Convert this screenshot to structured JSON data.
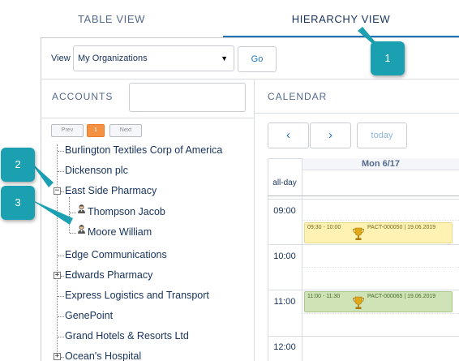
{
  "tabs": {
    "table_view": "TABLE VIEW",
    "hierarchy_view": "HIERARCHY VIEW"
  },
  "toolbar": {
    "view_label": "View",
    "view_selected": "My Organizations",
    "go_label": "Go"
  },
  "accounts": {
    "title": "ACCOUNTS",
    "search_value": "",
    "pager": {
      "prev": "Prev",
      "page": "1",
      "next": "Next"
    },
    "items": [
      {
        "label": "Burlington Textiles Corp of America"
      },
      {
        "label": "Dickenson plc"
      },
      {
        "label": "East Side Pharmacy",
        "toggle": "−"
      },
      {
        "label": "Thompson Jacob",
        "icon": "person-icon"
      },
      {
        "label": "Moore William",
        "icon": "person-icon"
      },
      {
        "label": "Edge Communications"
      },
      {
        "label": "Edwards Pharmacy",
        "toggle": "+"
      },
      {
        "label": "Express Logistics and Transport"
      },
      {
        "label": "GenePoint"
      },
      {
        "label": "Grand Hotels & Resorts Ltd"
      },
      {
        "label": "Ocean's Hospital",
        "toggle": "+"
      }
    ]
  },
  "calendar": {
    "title": "CALENDAR",
    "prev_icon": "‹",
    "next_icon": "›",
    "today_label": "today",
    "day_header": "Mon 6/17",
    "allday_label": "all-day",
    "hours": [
      "09:00",
      "10:00",
      "11:00",
      "12:00"
    ],
    "events": [
      {
        "time": "09:30 - 10:00",
        "ref": "PACT-000050 | 19.06.2019",
        "color": "#fff2b3",
        "icon": "trophy-icon"
      },
      {
        "time": "11:00 - 11:30",
        "ref": "PACT-000065 | 19.06.2019",
        "color": "#cfe3b6",
        "icon": "trophy-icon"
      }
    ]
  },
  "callouts": [
    "1",
    "2",
    "3"
  ],
  "colors": {
    "accent": "#1f73b7",
    "callout": "#1aa0b0",
    "pager_active": "#f59143"
  }
}
